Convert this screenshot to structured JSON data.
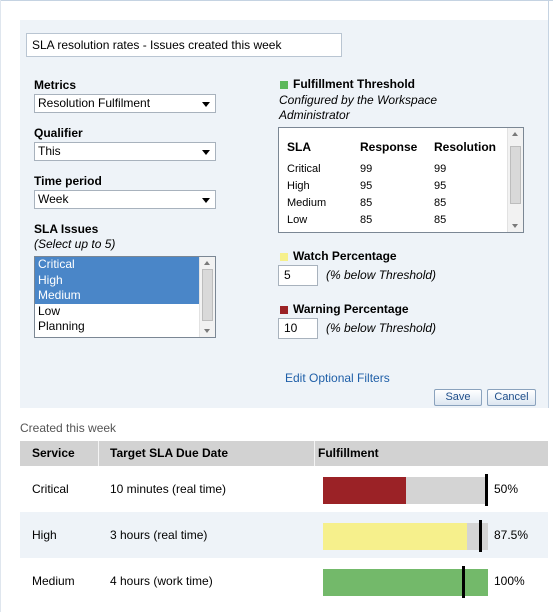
{
  "title_field": {
    "value": "SLA resolution rates - Issues created this week"
  },
  "metrics": {
    "label": "Metrics",
    "selected": "Resolution Fulfilment"
  },
  "qualifier": {
    "label": "Qualifier",
    "selected": "This"
  },
  "time_period": {
    "label": "Time period",
    "selected": "Week"
  },
  "sla_issues": {
    "label": "SLA Issues",
    "hint": "(Select up to 5)",
    "options": [
      {
        "label": "Critical",
        "selected": true
      },
      {
        "label": "High",
        "selected": true
      },
      {
        "label": "Medium",
        "selected": true
      },
      {
        "label": "Low",
        "selected": false
      },
      {
        "label": "Planning",
        "selected": false
      }
    ]
  },
  "fulfillment_threshold": {
    "label": "Fulfillment Threshold",
    "note_line1": "Configured by the Workspace",
    "note_line2": "Administrator",
    "color": "#5cb85c",
    "columns": [
      "SLA",
      "Response",
      "Resolution"
    ],
    "rows": [
      [
        "Critical",
        "99",
        "99"
      ],
      [
        "High",
        "95",
        "95"
      ],
      [
        "Medium",
        "85",
        "85"
      ],
      [
        "Low",
        "85",
        "85"
      ]
    ]
  },
  "watch_percentage": {
    "label": "Watch Percentage",
    "value": "5",
    "suffix": "(% below Threshold)",
    "color": "#f6f08c"
  },
  "warning_percentage": {
    "label": "Warning Percentage",
    "value": "10",
    "suffix": "(% below Threshold)",
    "color": "#9b2226"
  },
  "links": {
    "edit_filters": "Edit Optional Filters"
  },
  "buttons": {
    "save": "Save",
    "cancel": "Cancel"
  },
  "results": {
    "title": "Created this week",
    "columns": [
      "Service",
      "Target SLA Due Date",
      "Fulfillment"
    ],
    "rows": [
      {
        "service": "Critical",
        "target": "10 minutes (real time)",
        "fulfillment": 50,
        "fulfillment_label": "50%",
        "threshold": 99,
        "color": "#9b2226"
      },
      {
        "service": "High",
        "target": "3 hours (real time)",
        "fulfillment": 87.5,
        "fulfillment_label": "87.5%",
        "threshold": 95,
        "color": "#f6f08c"
      },
      {
        "service": "Medium",
        "target": "4 hours (work time)",
        "fulfillment": 100,
        "fulfillment_label": "100%",
        "threshold": 85,
        "color": "#73b96a"
      }
    ]
  }
}
